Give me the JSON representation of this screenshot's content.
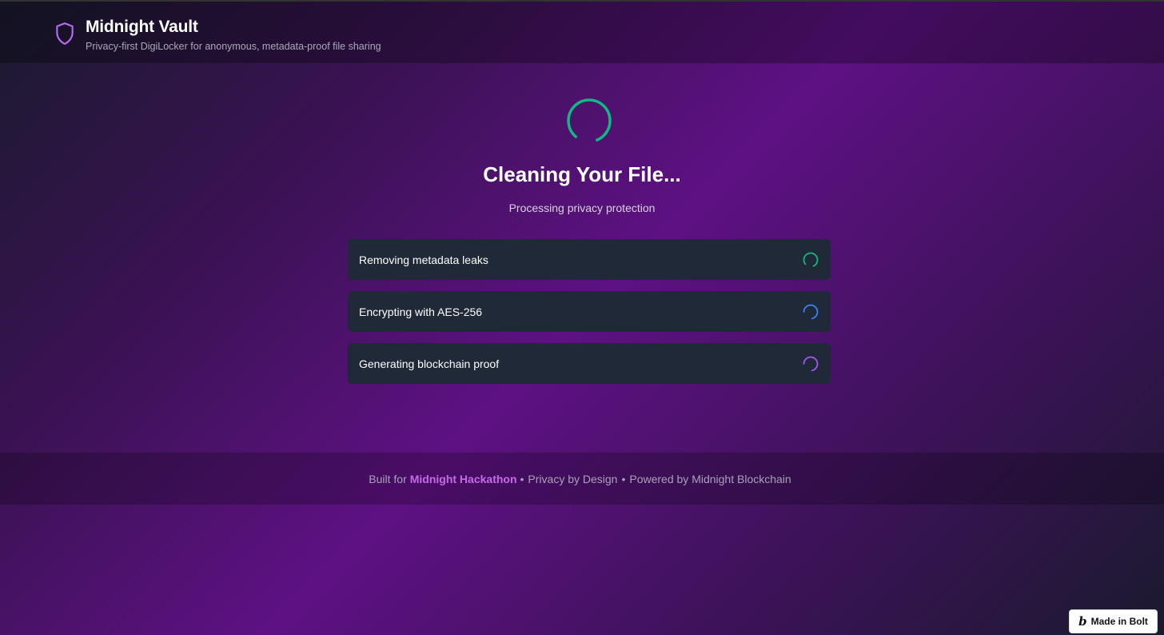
{
  "header": {
    "title": "Midnight Vault",
    "subtitle": "Privacy-first DigiLocker for anonymous, metadata-proof file sharing",
    "logo_icon": "shield-icon"
  },
  "main": {
    "title": "Cleaning Your File...",
    "subtitle": "Processing privacy protection",
    "spinner_color": "#10b981",
    "steps": [
      {
        "label": "Removing metadata leaks",
        "icon": "spinner-icon",
        "color": "#10b981"
      },
      {
        "label": "Encrypting with AES-256",
        "icon": "spinner-icon",
        "color": "#3b82f6"
      },
      {
        "label": "Generating blockchain proof",
        "icon": "spinner-icon",
        "color": "#a855f7"
      }
    ]
  },
  "footer": {
    "prefix": "Built for",
    "link": "Midnight Hackathon",
    "part2": "Privacy by Design",
    "part3": "Powered by Midnight Blockchain",
    "separator": "•"
  },
  "badge": {
    "icon": "bolt-logo-icon",
    "label": "Made in Bolt"
  },
  "colors": {
    "accent": "#c56be8",
    "card": "#1f2937"
  }
}
